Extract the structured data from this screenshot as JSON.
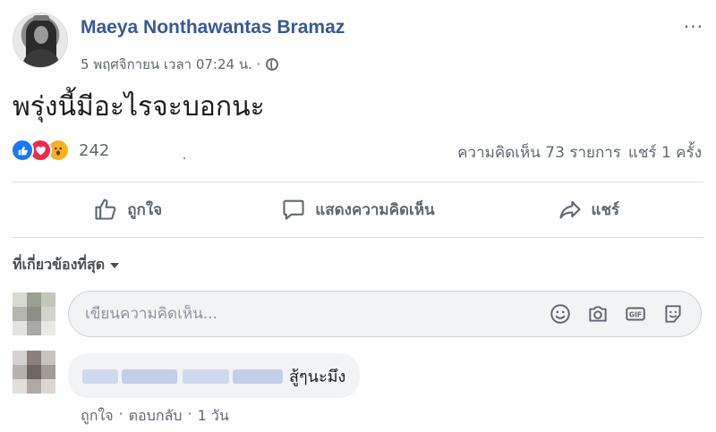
{
  "post": {
    "author": "Maeya Nonthawantas Bramaz",
    "timestamp": "5 พฤศจิกายน เวลา 07:24 น. ·",
    "privacy_icon": "globe-icon",
    "more_icon": "more-options-icon",
    "text": "พรุ่งนี้มีอะไรจะบอกนะ"
  },
  "reactions": {
    "types": [
      "like",
      "love",
      "wow"
    ],
    "count": "242",
    "comments_label": "ความคิดเห็น 73 รายการ",
    "shares_label": "แชร์ 1 ครั้ง"
  },
  "actions": {
    "like": "ถูกใจ",
    "comment": "แสดงความคิดเห็น",
    "share": "แชร์"
  },
  "sort": {
    "label": "ที่เกี่ยวข้องที่สุด"
  },
  "composer": {
    "placeholder": "เขียนความคิดเห็น...",
    "icons": [
      "emoji-icon",
      "camera-icon",
      "gif-icon",
      "sticker-icon"
    ]
  },
  "comment": {
    "text": "สู้ๆนะมึง",
    "like": "ถูกใจ",
    "separator": "·",
    "reply": "ตอบกลับ",
    "time": "1 วัน"
  },
  "colors": {
    "author": "#385898",
    "muted": "#606770",
    "like": "#1877f2",
    "love": "#f0284a",
    "wow": "#f7b125"
  }
}
